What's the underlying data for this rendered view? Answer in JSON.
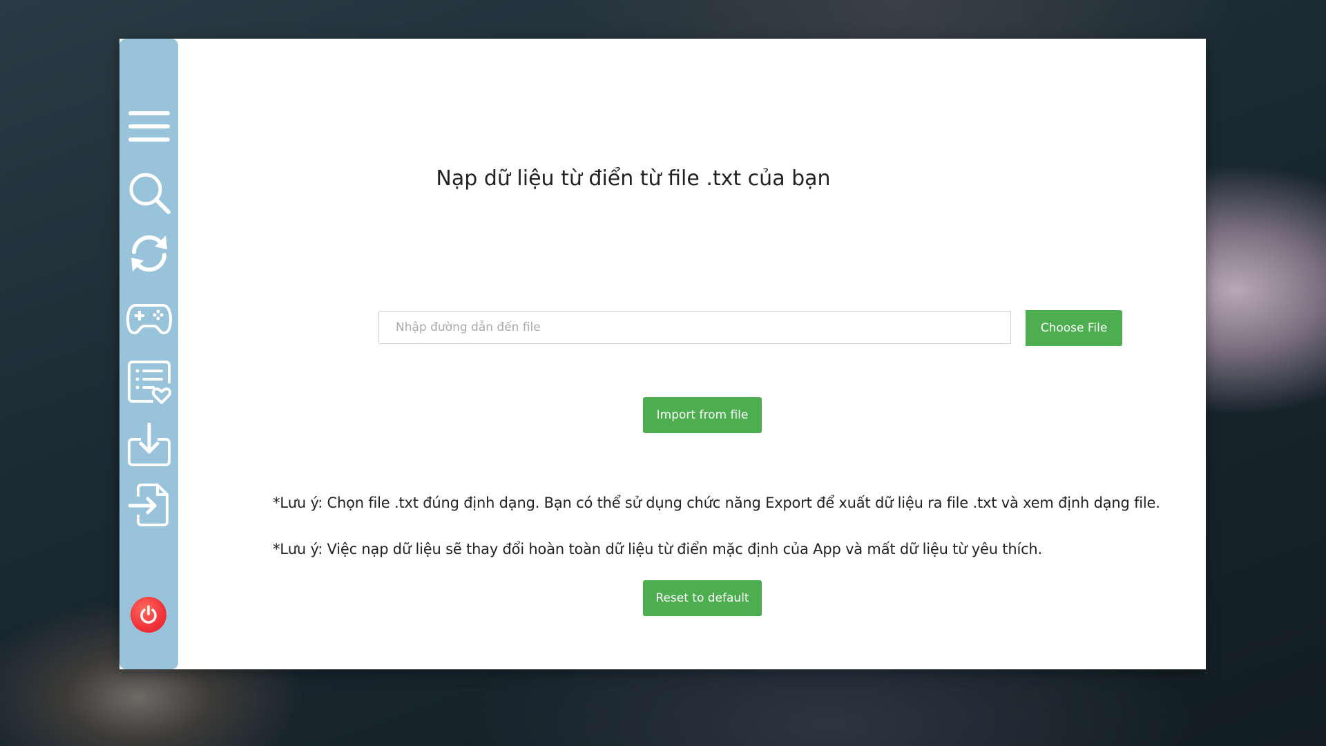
{
  "sidebar": {
    "items": [
      {
        "icon": "menu-icon"
      },
      {
        "icon": "search-icon"
      },
      {
        "icon": "sync-icon"
      },
      {
        "icon": "gamepad-icon"
      },
      {
        "icon": "favorite-list-icon"
      },
      {
        "icon": "download-icon"
      },
      {
        "icon": "import-file-icon"
      }
    ],
    "power_icon": "power-icon"
  },
  "main": {
    "title": "Nạp dữ liệu từ điển từ file .txt của bạn",
    "file_path_placeholder": "Nhập đường dẫn đến file",
    "file_path_value": "",
    "choose_file_label": "Choose File",
    "import_label": "Import from file",
    "note_1": "*Lưu ý: Chọn file .txt đúng định dạng. Bạn có thể sử dụng chức năng Export để xuất dữ liệu ra file .txt và xem định dạng file.",
    "note_2": "*Lưu ý: Việc nạp dữ liệu sẽ thay đổi hoàn toàn dữ liệu từ điển mặc định của App và mất dữ liệu từ yêu thích.",
    "reset_label": "Reset to default"
  },
  "colors": {
    "sidebar": "#98c3db",
    "button": "#4cae4f",
    "power": "#f0323a"
  }
}
